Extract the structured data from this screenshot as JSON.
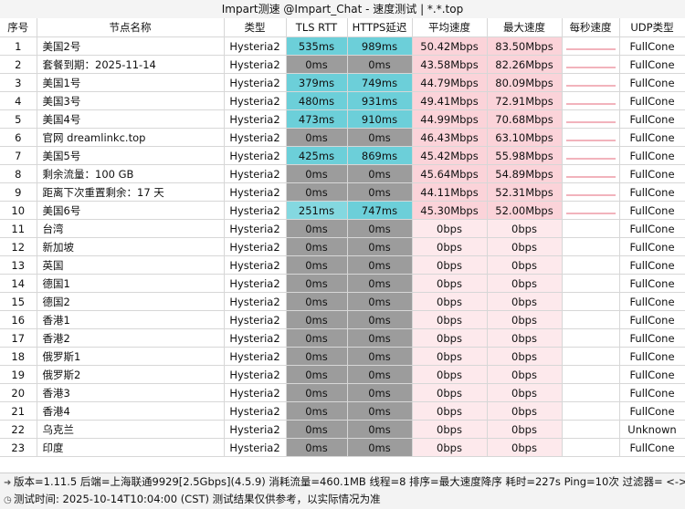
{
  "window": {
    "title": "Impart测速 @Impart_Chat - 速度测试 | *.*.top"
  },
  "table": {
    "headers": [
      "序号",
      "节点名称",
      "类型",
      "TLS RTT",
      "HTTPS延迟",
      "平均速度",
      "最大速度",
      "每秒速度",
      "UDP类型"
    ],
    "rows": [
      {
        "idx": "1",
        "name": "美国2号",
        "type": "Hysteria2",
        "tls": "535ms",
        "https": "989ms",
        "avg": "50.42Mbps",
        "max": "83.50Mbps",
        "udp": "FullCone"
      },
      {
        "idx": "2",
        "name": "套餐到期：2025-11-14",
        "type": "Hysteria2",
        "tls": "0ms",
        "https": "0ms",
        "avg": "43.58Mbps",
        "max": "82.26Mbps",
        "udp": "FullCone"
      },
      {
        "idx": "3",
        "name": "美国1号",
        "type": "Hysteria2",
        "tls": "379ms",
        "https": "749ms",
        "avg": "44.79Mbps",
        "max": "80.09Mbps",
        "udp": "FullCone"
      },
      {
        "idx": "4",
        "name": "美国3号",
        "type": "Hysteria2",
        "tls": "480ms",
        "https": "931ms",
        "avg": "49.41Mbps",
        "max": "72.91Mbps",
        "udp": "FullCone"
      },
      {
        "idx": "5",
        "name": "美国4号",
        "type": "Hysteria2",
        "tls": "473ms",
        "https": "910ms",
        "avg": "44.99Mbps",
        "max": "70.68Mbps",
        "udp": "FullCone"
      },
      {
        "idx": "6",
        "name": "官网 dreamlinkc.top",
        "type": "Hysteria2",
        "tls": "0ms",
        "https": "0ms",
        "avg": "46.43Mbps",
        "max": "63.10Mbps",
        "udp": "FullCone"
      },
      {
        "idx": "7",
        "name": "美国5号",
        "type": "Hysteria2",
        "tls": "425ms",
        "https": "869ms",
        "avg": "45.42Mbps",
        "max": "55.98Mbps",
        "udp": "FullCone"
      },
      {
        "idx": "8",
        "name": "剩余流量：100 GB",
        "type": "Hysteria2",
        "tls": "0ms",
        "https": "0ms",
        "avg": "45.64Mbps",
        "max": "54.89Mbps",
        "udp": "FullCone"
      },
      {
        "idx": "9",
        "name": "距离下次重置剩余：17 天",
        "type": "Hysteria2",
        "tls": "0ms",
        "https": "0ms",
        "avg": "44.11Mbps",
        "max": "52.31Mbps",
        "udp": "FullCone"
      },
      {
        "idx": "10",
        "name": "美国6号",
        "type": "Hysteria2",
        "tls": "251ms",
        "https": "747ms",
        "avg": "45.30Mbps",
        "max": "52.00Mbps",
        "udp": "FullCone"
      },
      {
        "idx": "11",
        "name": "台湾",
        "type": "Hysteria2",
        "tls": "0ms",
        "https": "0ms",
        "avg": "0bps",
        "max": "0bps",
        "udp": "FullCone"
      },
      {
        "idx": "12",
        "name": "新加坡",
        "type": "Hysteria2",
        "tls": "0ms",
        "https": "0ms",
        "avg": "0bps",
        "max": "0bps",
        "udp": "FullCone"
      },
      {
        "idx": "13",
        "name": "英国",
        "type": "Hysteria2",
        "tls": "0ms",
        "https": "0ms",
        "avg": "0bps",
        "max": "0bps",
        "udp": "FullCone"
      },
      {
        "idx": "14",
        "name": "德国1",
        "type": "Hysteria2",
        "tls": "0ms",
        "https": "0ms",
        "avg": "0bps",
        "max": "0bps",
        "udp": "FullCone"
      },
      {
        "idx": "15",
        "name": "德国2",
        "type": "Hysteria2",
        "tls": "0ms",
        "https": "0ms",
        "avg": "0bps",
        "max": "0bps",
        "udp": "FullCone"
      },
      {
        "idx": "16",
        "name": "香港1",
        "type": "Hysteria2",
        "tls": "0ms",
        "https": "0ms",
        "avg": "0bps",
        "max": "0bps",
        "udp": "FullCone"
      },
      {
        "idx": "17",
        "name": "香港2",
        "type": "Hysteria2",
        "tls": "0ms",
        "https": "0ms",
        "avg": "0bps",
        "max": "0bps",
        "udp": "FullCone"
      },
      {
        "idx": "18",
        "name": "俄罗斯1",
        "type": "Hysteria2",
        "tls": "0ms",
        "https": "0ms",
        "avg": "0bps",
        "max": "0bps",
        "udp": "FullCone"
      },
      {
        "idx": "19",
        "name": "俄罗斯2",
        "type": "Hysteria2",
        "tls": "0ms",
        "https": "0ms",
        "avg": "0bps",
        "max": "0bps",
        "udp": "FullCone"
      },
      {
        "idx": "20",
        "name": "香港3",
        "type": "Hysteria2",
        "tls": "0ms",
        "https": "0ms",
        "avg": "0bps",
        "max": "0bps",
        "udp": "FullCone"
      },
      {
        "idx": "21",
        "name": "香港4",
        "type": "Hysteria2",
        "tls": "0ms",
        "https": "0ms",
        "avg": "0bps",
        "max": "0bps",
        "udp": "FullCone"
      },
      {
        "idx": "22",
        "name": "乌克兰",
        "type": "Hysteria2",
        "tls": "0ms",
        "https": "0ms",
        "avg": "0bps",
        "max": "0bps",
        "udp": "Unknown"
      },
      {
        "idx": "23",
        "name": "印度",
        "type": "Hysteria2",
        "tls": "0ms",
        "https": "0ms",
        "avg": "0bps",
        "max": "0bps",
        "udp": "FullCone"
      }
    ]
  },
  "footer": {
    "line1": "版本=1.11.5  后端=上海联通9929[2.5Gbps](4.5.9) 消耗流量=460.1MB  线程=8  排序=最大速度降序  耗时=227s  Ping=10次  过滤器= <->",
    "line2": "测试时间: 2025-10-14T10:04:00 (CST)  测试结果仅供参考，以实际情况为准"
  },
  "colors": {
    "latency_fast": "#6ccfd9",
    "latency_zero": "#9c9c9c",
    "speed_fast": "#fbd3d9",
    "speed_zero": "#fde9ec"
  }
}
